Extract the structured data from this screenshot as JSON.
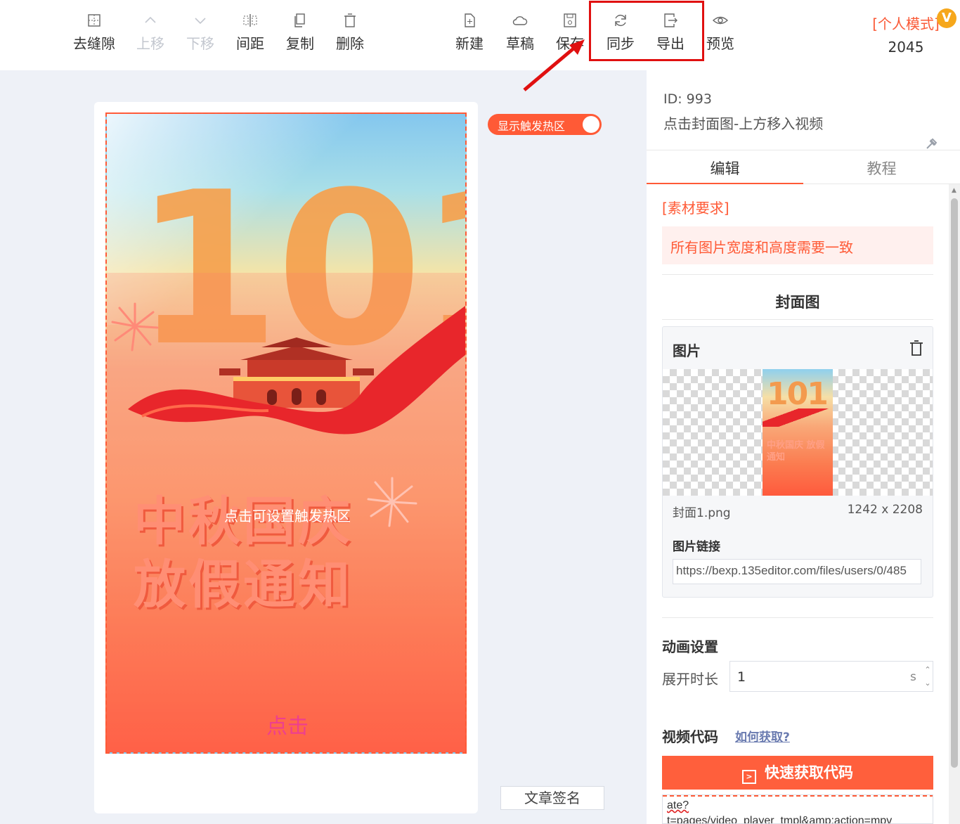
{
  "toolbar": {
    "left": [
      {
        "label": "去缝隙",
        "icon": "grid-icon",
        "disabled": false
      },
      {
        "label": "上移",
        "icon": "chevron-up-icon",
        "disabled": true
      },
      {
        "label": "下移",
        "icon": "chevron-down-icon",
        "disabled": true
      },
      {
        "label": "间距",
        "icon": "spacing-icon",
        "disabled": false
      },
      {
        "label": "复制",
        "icon": "copy-icon",
        "disabled": false
      },
      {
        "label": "删除",
        "icon": "trash-icon",
        "disabled": false
      }
    ],
    "right": [
      {
        "label": "新建",
        "icon": "new-file-icon"
      },
      {
        "label": "草稿",
        "icon": "cloud-icon"
      },
      {
        "label": "保存",
        "icon": "save-icon"
      },
      {
        "label": "同步",
        "icon": "sync-icon"
      },
      {
        "label": "导出",
        "icon": "export-icon"
      },
      {
        "label": "预览",
        "icon": "eye-icon"
      }
    ],
    "mode_label": "[个人模式]",
    "vip_badge": "V",
    "mode_number": "2045"
  },
  "canvas": {
    "poster_number": "101",
    "poster_title_line1": "中秋国庆",
    "poster_title_line2": "放假通知",
    "hotspot_hint": "点击可设置触发热区",
    "click_label": "点击",
    "toggle_label": "显示触发热区",
    "signature_button": "文章签名"
  },
  "panel": {
    "id_text": "ID: 993",
    "name": "点击封面图-上方移入视频",
    "tabs": [
      {
        "label": "编辑",
        "active": true
      },
      {
        "label": "教程",
        "active": false
      }
    ],
    "requirement_title": "[素材要求]",
    "requirement_text": "所有图片宽度和高度需要一致",
    "cover_section": "封面图",
    "image_card": {
      "title": "图片",
      "thumb_number": "101",
      "thumb_text": "中秋国庆 放假通知",
      "file_name": "封面1.png",
      "file_size": "1242 x 2208",
      "link_label": "图片链接",
      "link_value": "https://bexp.135editor.com/files/users/0/485"
    },
    "animation_title": "动画设置",
    "duration_label": "展开时长",
    "duration_value": "1",
    "duration_unit": "s",
    "video_code_title": "视频代码",
    "how_to_link": "如何获取?",
    "quick_button": "快速获取代码",
    "code_line1": "ate?",
    "code_line2": "t=pages/video_player_tmpl&amp;action=mpv"
  },
  "colors": {
    "accent": "#ff5a36",
    "highlight_box": "#e01010"
  }
}
